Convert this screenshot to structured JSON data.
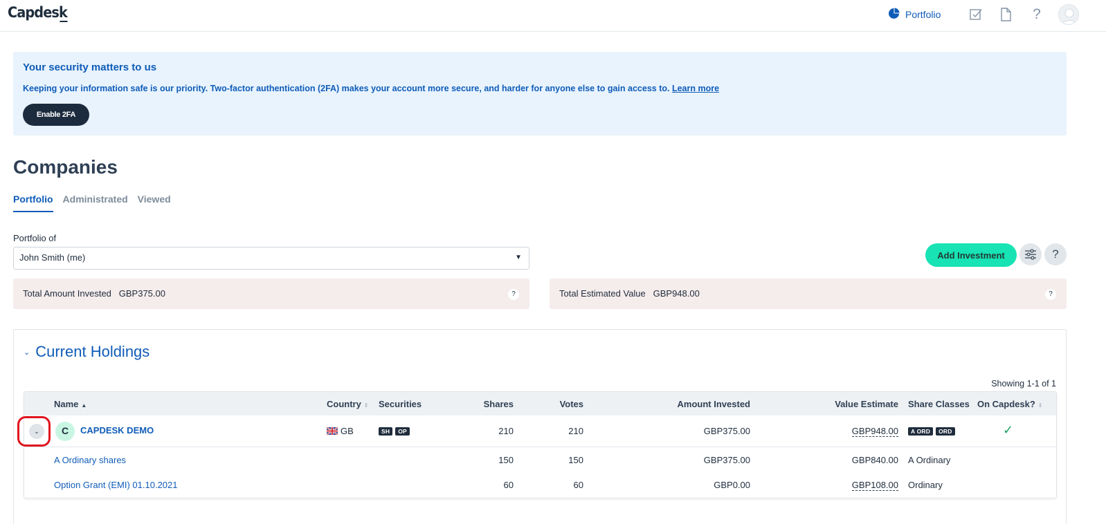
{
  "header": {
    "logo": "Capdesk",
    "nav_portfolio": "Portfolio",
    "icons": [
      "portfolio-pie-icon",
      "tasks-check-icon",
      "document-icon",
      "help-icon",
      "user-avatar-icon"
    ]
  },
  "banner": {
    "title": "Your security matters to us",
    "text": "Keeping your information safe is our priority. Two-factor authentication (2FA) makes your account more secure, and harder for anyone else to gain access to.",
    "link": "Learn more",
    "button": "Enable 2FA"
  },
  "page": {
    "title": "Companies",
    "tabs": [
      {
        "label": "Portfolio",
        "active": true
      },
      {
        "label": "Administrated",
        "active": false
      },
      {
        "label": "Viewed",
        "active": false
      }
    ],
    "portfolio_of_label": "Portfolio of",
    "portfolio_of_value": "John Smith (me)",
    "add_investment": "Add Investment",
    "filter_icon": "sliders-icon",
    "help_icon": "help-icon"
  },
  "stats": {
    "invested_label": "Total Amount Invested",
    "invested_value": "GBP375.00",
    "estimated_label": "Total Estimated Value",
    "estimated_value": "GBP948.00",
    "help_mark": "?"
  },
  "holdings": {
    "title": "Current Holdings",
    "showing": "Showing 1-1 of 1",
    "columns": [
      "Name",
      "Country",
      "Securities",
      "Shares",
      "Votes",
      "Amount Invested",
      "Value Estimate",
      "Share Classes",
      "On Capdesk?"
    ],
    "company": {
      "logo_letter": "C",
      "name": "CAPDESK DEMO",
      "country": "GB",
      "securities": [
        "SH",
        "OP"
      ],
      "shares": "210",
      "votes": "210",
      "amount_invested": "GBP375.00",
      "value_estimate": "GBP948.00",
      "share_classes": [
        "A ORD",
        "ORD"
      ],
      "on_capdesk": "✓"
    },
    "sub_rows": [
      {
        "name": "A Ordinary shares",
        "shares": "150",
        "votes": "150",
        "amount_invested": "GBP375.00",
        "value_estimate": "GBP840.00",
        "share_class": "A Ordinary"
      },
      {
        "name": "Option Grant (EMI) 01.10.2021",
        "shares": "60",
        "votes": "60",
        "amount_invested": "GBP0.00",
        "value_estimate": "GBP108.00",
        "share_class": "Ordinary"
      }
    ]
  },
  "colors": {
    "brand_blue": "#0f5cb8",
    "accent_green": "#17e3b4",
    "dark": "#1c2b3d",
    "banner_bg": "#e8f3fd",
    "stat_bg": "#f5ecec",
    "highlight_red": "#e0141e"
  }
}
